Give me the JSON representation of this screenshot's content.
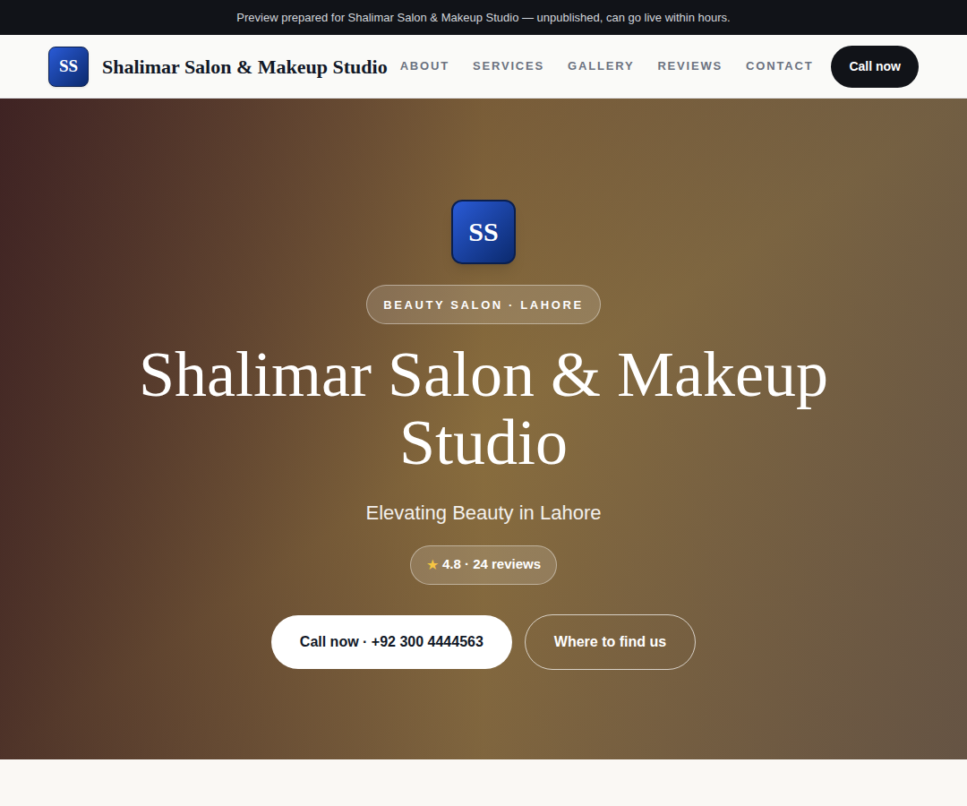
{
  "banner": {
    "text": "Preview prepared for Shalimar Salon & Makeup Studio — unpublished, can go live within hours."
  },
  "nav": {
    "logo": "SS",
    "brand": "Shalimar Salon & Makeup Studio",
    "links": [
      "ABOUT",
      "SERVICES",
      "GALLERY",
      "REVIEWS",
      "CONTACT"
    ],
    "cta": "Call now"
  },
  "hero": {
    "logo": "SS",
    "badge": "BEAUTY SALON · LAHORE",
    "title": "Shalimar Salon & Makeup Studio",
    "tagline": "Elevating Beauty in Lahore",
    "rating": {
      "star": "★",
      "text": "4.8 · 24 reviews"
    },
    "buttons": [
      {
        "label": "Call now · +92 300 4444563",
        "kind": "primary"
      },
      {
        "label": "Where to find us",
        "kind": "outline"
      }
    ]
  }
}
